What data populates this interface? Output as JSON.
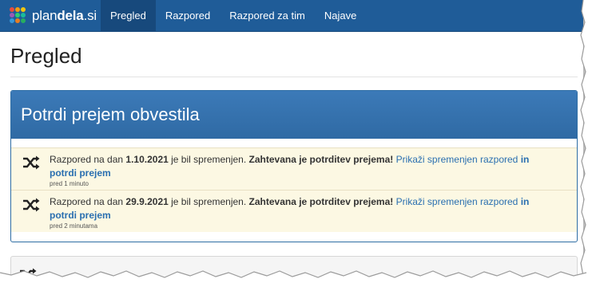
{
  "brand": {
    "name_plain": "plan",
    "name_bold": "dela",
    "name_suffix": ".si"
  },
  "nav": {
    "items": [
      {
        "label": "Pregled",
        "active": true
      },
      {
        "label": "Razpored",
        "active": false
      },
      {
        "label": "Razpored za tim",
        "active": false
      },
      {
        "label": "Najave",
        "active": false
      }
    ]
  },
  "page": {
    "title": "Pregled"
  },
  "panel": {
    "heading": "Potrdi prejem obvestila"
  },
  "notices": [
    {
      "text_prefix": "Razpored na dan ",
      "date": "1.10.2021",
      "text_mid": " je bil spremenjen. ",
      "required": "Zahtevana je potrditev prejema!",
      "link_text": "Prikaži spremenjen razpored",
      "link_bold": "in potrdi prejem",
      "time": "pred 1 minuto",
      "icon": "shuffle-icon"
    },
    {
      "text_prefix": "Razpored na dan ",
      "date": "29.9.2021",
      "text_mid": " je bil spremenjen. ",
      "required": "Zahtevana je potrditev prejema!",
      "link_text": "Prikaži spremenjen razpored",
      "link_bold": "in potrdi prejem",
      "time": "pred 2 minutama",
      "icon": "shuffle-icon"
    }
  ],
  "colors": {
    "navbar": "#1f5c98",
    "nav_active": "#17497c",
    "panel_heading": "#3373b0",
    "notice_bg": "#fcf8e3",
    "link": "#2a6fb0"
  }
}
